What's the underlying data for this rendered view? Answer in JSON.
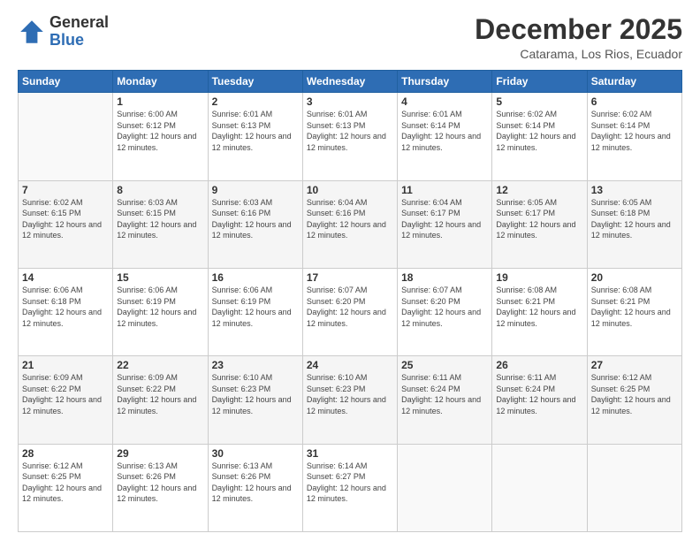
{
  "logo": {
    "general": "General",
    "blue": "Blue"
  },
  "header": {
    "month": "December 2025",
    "location": "Catarama, Los Rios, Ecuador"
  },
  "weekdays": [
    "Sunday",
    "Monday",
    "Tuesday",
    "Wednesday",
    "Thursday",
    "Friday",
    "Saturday"
  ],
  "weeks": [
    [
      {
        "day": "",
        "sunrise": "",
        "sunset": "",
        "daylight": ""
      },
      {
        "day": "1",
        "sunrise": "Sunrise: 6:00 AM",
        "sunset": "Sunset: 6:12 PM",
        "daylight": "Daylight: 12 hours and 12 minutes."
      },
      {
        "day": "2",
        "sunrise": "Sunrise: 6:01 AM",
        "sunset": "Sunset: 6:13 PM",
        "daylight": "Daylight: 12 hours and 12 minutes."
      },
      {
        "day": "3",
        "sunrise": "Sunrise: 6:01 AM",
        "sunset": "Sunset: 6:13 PM",
        "daylight": "Daylight: 12 hours and 12 minutes."
      },
      {
        "day": "4",
        "sunrise": "Sunrise: 6:01 AM",
        "sunset": "Sunset: 6:14 PM",
        "daylight": "Daylight: 12 hours and 12 minutes."
      },
      {
        "day": "5",
        "sunrise": "Sunrise: 6:02 AM",
        "sunset": "Sunset: 6:14 PM",
        "daylight": "Daylight: 12 hours and 12 minutes."
      },
      {
        "day": "6",
        "sunrise": "Sunrise: 6:02 AM",
        "sunset": "Sunset: 6:14 PM",
        "daylight": "Daylight: 12 hours and 12 minutes."
      }
    ],
    [
      {
        "day": "7",
        "sunrise": "Sunrise: 6:02 AM",
        "sunset": "Sunset: 6:15 PM",
        "daylight": "Daylight: 12 hours and 12 minutes."
      },
      {
        "day": "8",
        "sunrise": "Sunrise: 6:03 AM",
        "sunset": "Sunset: 6:15 PM",
        "daylight": "Daylight: 12 hours and 12 minutes."
      },
      {
        "day": "9",
        "sunrise": "Sunrise: 6:03 AM",
        "sunset": "Sunset: 6:16 PM",
        "daylight": "Daylight: 12 hours and 12 minutes."
      },
      {
        "day": "10",
        "sunrise": "Sunrise: 6:04 AM",
        "sunset": "Sunset: 6:16 PM",
        "daylight": "Daylight: 12 hours and 12 minutes."
      },
      {
        "day": "11",
        "sunrise": "Sunrise: 6:04 AM",
        "sunset": "Sunset: 6:17 PM",
        "daylight": "Daylight: 12 hours and 12 minutes."
      },
      {
        "day": "12",
        "sunrise": "Sunrise: 6:05 AM",
        "sunset": "Sunset: 6:17 PM",
        "daylight": "Daylight: 12 hours and 12 minutes."
      },
      {
        "day": "13",
        "sunrise": "Sunrise: 6:05 AM",
        "sunset": "Sunset: 6:18 PM",
        "daylight": "Daylight: 12 hours and 12 minutes."
      }
    ],
    [
      {
        "day": "14",
        "sunrise": "Sunrise: 6:06 AM",
        "sunset": "Sunset: 6:18 PM",
        "daylight": "Daylight: 12 hours and 12 minutes."
      },
      {
        "day": "15",
        "sunrise": "Sunrise: 6:06 AM",
        "sunset": "Sunset: 6:19 PM",
        "daylight": "Daylight: 12 hours and 12 minutes."
      },
      {
        "day": "16",
        "sunrise": "Sunrise: 6:06 AM",
        "sunset": "Sunset: 6:19 PM",
        "daylight": "Daylight: 12 hours and 12 minutes."
      },
      {
        "day": "17",
        "sunrise": "Sunrise: 6:07 AM",
        "sunset": "Sunset: 6:20 PM",
        "daylight": "Daylight: 12 hours and 12 minutes."
      },
      {
        "day": "18",
        "sunrise": "Sunrise: 6:07 AM",
        "sunset": "Sunset: 6:20 PM",
        "daylight": "Daylight: 12 hours and 12 minutes."
      },
      {
        "day": "19",
        "sunrise": "Sunrise: 6:08 AM",
        "sunset": "Sunset: 6:21 PM",
        "daylight": "Daylight: 12 hours and 12 minutes."
      },
      {
        "day": "20",
        "sunrise": "Sunrise: 6:08 AM",
        "sunset": "Sunset: 6:21 PM",
        "daylight": "Daylight: 12 hours and 12 minutes."
      }
    ],
    [
      {
        "day": "21",
        "sunrise": "Sunrise: 6:09 AM",
        "sunset": "Sunset: 6:22 PM",
        "daylight": "Daylight: 12 hours and 12 minutes."
      },
      {
        "day": "22",
        "sunrise": "Sunrise: 6:09 AM",
        "sunset": "Sunset: 6:22 PM",
        "daylight": "Daylight: 12 hours and 12 minutes."
      },
      {
        "day": "23",
        "sunrise": "Sunrise: 6:10 AM",
        "sunset": "Sunset: 6:23 PM",
        "daylight": "Daylight: 12 hours and 12 minutes."
      },
      {
        "day": "24",
        "sunrise": "Sunrise: 6:10 AM",
        "sunset": "Sunset: 6:23 PM",
        "daylight": "Daylight: 12 hours and 12 minutes."
      },
      {
        "day": "25",
        "sunrise": "Sunrise: 6:11 AM",
        "sunset": "Sunset: 6:24 PM",
        "daylight": "Daylight: 12 hours and 12 minutes."
      },
      {
        "day": "26",
        "sunrise": "Sunrise: 6:11 AM",
        "sunset": "Sunset: 6:24 PM",
        "daylight": "Daylight: 12 hours and 12 minutes."
      },
      {
        "day": "27",
        "sunrise": "Sunrise: 6:12 AM",
        "sunset": "Sunset: 6:25 PM",
        "daylight": "Daylight: 12 hours and 12 minutes."
      }
    ],
    [
      {
        "day": "28",
        "sunrise": "Sunrise: 6:12 AM",
        "sunset": "Sunset: 6:25 PM",
        "daylight": "Daylight: 12 hours and 12 minutes."
      },
      {
        "day": "29",
        "sunrise": "Sunrise: 6:13 AM",
        "sunset": "Sunset: 6:26 PM",
        "daylight": "Daylight: 12 hours and 12 minutes."
      },
      {
        "day": "30",
        "sunrise": "Sunrise: 6:13 AM",
        "sunset": "Sunset: 6:26 PM",
        "daylight": "Daylight: 12 hours and 12 minutes."
      },
      {
        "day": "31",
        "sunrise": "Sunrise: 6:14 AM",
        "sunset": "Sunset: 6:27 PM",
        "daylight": "Daylight: 12 hours and 12 minutes."
      },
      {
        "day": "",
        "sunrise": "",
        "sunset": "",
        "daylight": ""
      },
      {
        "day": "",
        "sunrise": "",
        "sunset": "",
        "daylight": ""
      },
      {
        "day": "",
        "sunrise": "",
        "sunset": "",
        "daylight": ""
      }
    ]
  ]
}
